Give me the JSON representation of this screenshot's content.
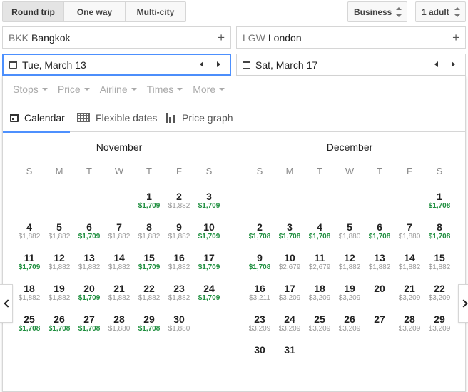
{
  "trip_types": [
    "Round trip",
    "One way",
    "Multi-city"
  ],
  "cabin": "Business",
  "passengers": "1 adult",
  "origin": {
    "code": "BKK",
    "city": "Bangkok"
  },
  "destination": {
    "code": "LGW",
    "city": "London"
  },
  "departure_date": "Tue, March 13",
  "return_date": "Sat, March 17",
  "filters": [
    "Stops",
    "Price",
    "Airline",
    "Times",
    "More"
  ],
  "tabs": {
    "calendar": "Calendar",
    "flexible": "Flexible dates",
    "graph": "Price graph"
  },
  "weekdays": [
    "S",
    "M",
    "T",
    "W",
    "T",
    "F",
    "S"
  ],
  "colors": {
    "accent": "#4d90fe",
    "low_price": "#1e8e3e",
    "price": "#999999"
  },
  "months": [
    {
      "name": "November",
      "weeks": [
        [
          null,
          null,
          null,
          null,
          {
            "d": "1",
            "p": "$1,709",
            "low": true
          },
          {
            "d": "2",
            "p": "$1,882"
          },
          {
            "d": "3",
            "p": "$1,709",
            "low": true
          }
        ],
        [
          {
            "d": "4",
            "p": "$1,882"
          },
          {
            "d": "5",
            "p": "$1,882"
          },
          {
            "d": "6",
            "p": "$1,709",
            "low": true
          },
          {
            "d": "7",
            "p": "$1,882"
          },
          {
            "d": "8",
            "p": "$1,882"
          },
          {
            "d": "9",
            "p": "$1,882"
          },
          {
            "d": "10",
            "p": "$1,709",
            "low": true
          }
        ],
        [
          {
            "d": "11",
            "p": "$1,709",
            "low": true
          },
          {
            "d": "12",
            "p": "$1,882"
          },
          {
            "d": "13",
            "p": "$1,882"
          },
          {
            "d": "14",
            "p": "$1,882"
          },
          {
            "d": "15",
            "p": "$1,709",
            "low": true
          },
          {
            "d": "16",
            "p": "$1,882"
          },
          {
            "d": "17",
            "p": "$1,709",
            "low": true
          }
        ],
        [
          {
            "d": "18",
            "p": "$1,882"
          },
          {
            "d": "19",
            "p": "$1,882"
          },
          {
            "d": "20",
            "p": "$1,709",
            "low": true
          },
          {
            "d": "21",
            "p": "$1,882"
          },
          {
            "d": "22",
            "p": "$1,882"
          },
          {
            "d": "23",
            "p": "$1,882"
          },
          {
            "d": "24",
            "p": "$1,709",
            "low": true
          }
        ],
        [
          {
            "d": "25",
            "p": "$1,708",
            "low": true
          },
          {
            "d": "26",
            "p": "$1,708",
            "low": true
          },
          {
            "d": "27",
            "p": "$1,708",
            "low": true
          },
          {
            "d": "28",
            "p": "$1,880"
          },
          {
            "d": "29",
            "p": "$1,708",
            "low": true
          },
          {
            "d": "30",
            "p": "$1,880"
          },
          null
        ]
      ]
    },
    {
      "name": "December",
      "weeks": [
        [
          null,
          null,
          null,
          null,
          null,
          null,
          {
            "d": "1",
            "p": "$1,708",
            "low": true
          }
        ],
        [
          {
            "d": "2",
            "p": "$1,708",
            "low": true
          },
          {
            "d": "3",
            "p": "$1,708",
            "low": true
          },
          {
            "d": "4",
            "p": "$1,708",
            "low": true
          },
          {
            "d": "5",
            "p": "$1,880"
          },
          {
            "d": "6",
            "p": "$1,708",
            "low": true
          },
          {
            "d": "7",
            "p": "$1,880"
          },
          {
            "d": "8",
            "p": "$1,708",
            "low": true
          }
        ],
        [
          {
            "d": "9",
            "p": "$1,708",
            "low": true
          },
          {
            "d": "10",
            "p": "$2,679"
          },
          {
            "d": "11",
            "p": "$2,679"
          },
          {
            "d": "12",
            "p": "$1,882"
          },
          {
            "d": "13",
            "p": "$1,882"
          },
          {
            "d": "14",
            "p": "$1,882"
          },
          {
            "d": "15",
            "p": "$1,882"
          }
        ],
        [
          {
            "d": "16",
            "p": "$3,211"
          },
          {
            "d": "17",
            "p": "$3,209"
          },
          {
            "d": "18",
            "p": "$3,209"
          },
          {
            "d": "19",
            "p": "$3,209"
          },
          {
            "d": "20",
            "p": ""
          },
          {
            "d": "21",
            "p": "$3,209"
          },
          {
            "d": "22",
            "p": "$3,209"
          }
        ],
        [
          {
            "d": "23",
            "p": "$3,209"
          },
          {
            "d": "24",
            "p": "$3,209"
          },
          {
            "d": "25",
            "p": "$3,209"
          },
          {
            "d": "26",
            "p": "$3,209"
          },
          {
            "d": "27",
            "p": ""
          },
          {
            "d": "28",
            "p": "$3,209"
          },
          {
            "d": "29",
            "p": "$3,209"
          }
        ],
        [
          {
            "d": "30",
            "p": ""
          },
          {
            "d": "31",
            "p": ""
          },
          null,
          null,
          null,
          null,
          null
        ]
      ]
    }
  ]
}
